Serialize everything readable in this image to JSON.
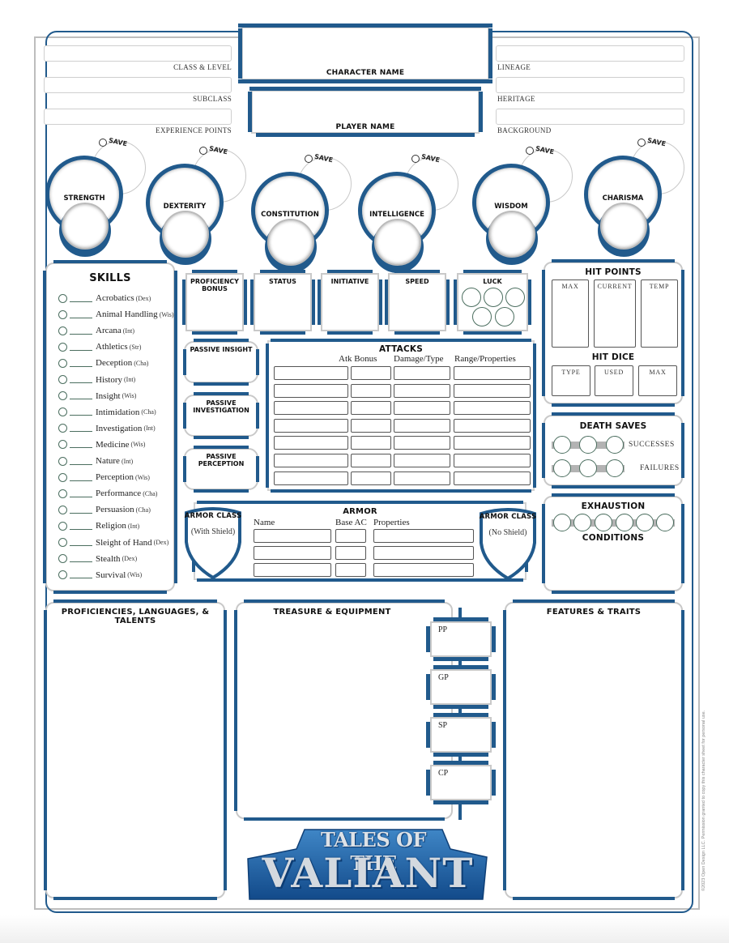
{
  "header": {
    "left_fields": [
      {
        "label": "CLASS & LEVEL",
        "value": ""
      },
      {
        "label": "SUBCLASS",
        "value": ""
      },
      {
        "label": "EXPERIENCE POINTS",
        "value": ""
      }
    ],
    "character_name_label": "CHARACTER NAME",
    "character_name_value": "",
    "player_name_label": "PLAYER NAME",
    "player_name_value": "",
    "right_fields": [
      {
        "label": "LINEAGE",
        "value": ""
      },
      {
        "label": "HERITAGE",
        "value": ""
      },
      {
        "label": "BACKGROUND",
        "value": ""
      }
    ]
  },
  "abilities": [
    {
      "name": "STRENGTH",
      "save_label": "SAVE",
      "score": "",
      "modifier": ""
    },
    {
      "name": "DEXTERITY",
      "save_label": "SAVE",
      "score": "",
      "modifier": ""
    },
    {
      "name": "CONSTITUTION",
      "save_label": "SAVE",
      "score": "",
      "modifier": ""
    },
    {
      "name": "INTELLIGENCE",
      "save_label": "SAVE",
      "score": "",
      "modifier": ""
    },
    {
      "name": "WISDOM",
      "save_label": "SAVE",
      "score": "",
      "modifier": ""
    },
    {
      "name": "CHARISMA",
      "save_label": "SAVE",
      "score": "",
      "modifier": ""
    }
  ],
  "skills": {
    "title": "SKILLS",
    "items": [
      {
        "name": "Acrobatics",
        "attr": "(Dex)"
      },
      {
        "name": "Animal Handling",
        "attr": "(Wis)"
      },
      {
        "name": "Arcana",
        "attr": "(Int)"
      },
      {
        "name": "Athletics",
        "attr": "(Str)"
      },
      {
        "name": "Deception",
        "attr": "(Cha)"
      },
      {
        "name": "History",
        "attr": "(Int)"
      },
      {
        "name": "Insight",
        "attr": "(Wis)"
      },
      {
        "name": "Intimidation",
        "attr": "(Cha)"
      },
      {
        "name": "Investigation",
        "attr": "(Int)"
      },
      {
        "name": "Medicine",
        "attr": "(Wis)"
      },
      {
        "name": "Nature",
        "attr": "(Int)"
      },
      {
        "name": "Perception",
        "attr": "(Wis)"
      },
      {
        "name": "Performance",
        "attr": "(Cha)"
      },
      {
        "name": "Persuasion",
        "attr": "(Cha)"
      },
      {
        "name": "Religion",
        "attr": "(Int)"
      },
      {
        "name": "Sleight of Hand",
        "attr": "(Dex)"
      },
      {
        "name": "Stealth",
        "attr": "(Dex)"
      },
      {
        "name": "Survival",
        "attr": "(Wis)"
      }
    ]
  },
  "stat_boxes": {
    "proficiency_bonus": "PROFICIENCY BONUS",
    "status": "STATUS",
    "initiative": "INITIATIVE",
    "speed": "SPEED",
    "luck": "LUCK",
    "luck_points": 5
  },
  "passives": {
    "insight": "PASSIVE INSIGHT",
    "investigation": "PASSIVE INVESTIGATION",
    "perception": "PASSIVE PERCEPTION"
  },
  "attacks": {
    "title": "ATTACKS",
    "columns": [
      "",
      "Atk Bonus",
      "Damage/Type",
      "Range/Properties"
    ],
    "row_count": 7
  },
  "hit_points": {
    "title": "HIT POINTS",
    "fields": [
      "MAX",
      "CURRENT",
      "TEMP"
    ],
    "hit_dice_title": "HIT DICE",
    "hit_dice_fields": [
      "TYPE",
      "USED",
      "MAX"
    ]
  },
  "death_saves": {
    "title": "DEATH SAVES",
    "successes_label": "SUCCESSES",
    "failures_label": "FAILURES",
    "successes": 0,
    "failures": 0
  },
  "exhaustion": {
    "title": "EXHAUSTION",
    "levels": 6,
    "current": 0,
    "conditions_title": "CONDITIONS"
  },
  "armor": {
    "title": "ARMOR",
    "ac_with_shield": {
      "title": "ARMOR CLASS",
      "sub": "(With Shield)"
    },
    "ac_no_shield": {
      "title": "ARMOR CLASS",
      "sub": "(No Shield)"
    },
    "columns": [
      "Name",
      "Base AC",
      "Properties"
    ],
    "row_count": 3
  },
  "proficiencies": {
    "title": "PROFICIENCIES, LANGUAGES, & TALENTS"
  },
  "treasure": {
    "title": "TREASURE & EQUIPMENT",
    "coins": [
      "PP",
      "GP",
      "SP",
      "CP"
    ]
  },
  "features": {
    "title": "FEATURES & TRAITS"
  },
  "logo": {
    "line1": "TALES OF THE",
    "line2": "VALIANT"
  },
  "copyright": "©2023 Open Design LLC. Permission granted to copy this character sheet for personal use.",
  "colors": {
    "accent_blue": "#215a8c",
    "frame_gray": "#c9c9c9",
    "bubble_green": "#4b6e5f"
  }
}
